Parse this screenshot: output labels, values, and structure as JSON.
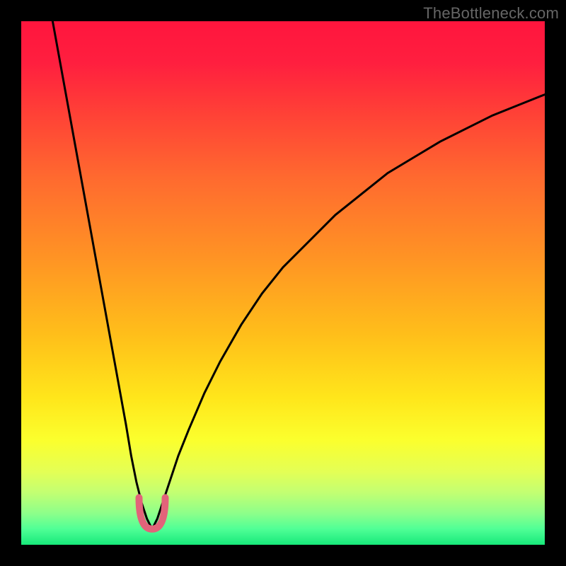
{
  "watermark": "TheBottleneck.com",
  "chart_data": {
    "type": "line",
    "title": "",
    "xlabel": "",
    "ylabel": "",
    "xlim": [
      0,
      100
    ],
    "ylim": [
      0,
      100
    ],
    "grid": false,
    "legend": false,
    "annotations": [],
    "description": "Two black curves descending to a shared minimum near x≈25 over a vertical rainbow gradient (red at top through green at bottom). A small pink U-shaped marker sits at the valley where the curves meet.",
    "series": [
      {
        "name": "left-curve",
        "x": [
          6,
          8,
          10,
          12,
          14,
          16,
          18,
          20,
          21,
          22,
          23,
          24,
          25
        ],
        "y": [
          100,
          89,
          78,
          67,
          56,
          45,
          34,
          23,
          17,
          12,
          8,
          5,
          3
        ]
      },
      {
        "name": "right-curve",
        "x": [
          25,
          26,
          27,
          28,
          30,
          32,
          35,
          38,
          42,
          46,
          50,
          55,
          60,
          65,
          70,
          75,
          80,
          85,
          90,
          95,
          100
        ],
        "y": [
          3,
          5,
          8,
          11,
          17,
          22,
          29,
          35,
          42,
          48,
          53,
          58,
          63,
          67,
          71,
          74,
          77,
          79.5,
          82,
          84,
          86
        ]
      }
    ],
    "valley_marker": {
      "x": 25,
      "y": 3,
      "width": 5,
      "height": 6
    },
    "gradient_stops": [
      {
        "offset": 0.0,
        "color": "#ff153d"
      },
      {
        "offset": 0.08,
        "color": "#ff1f3f"
      },
      {
        "offset": 0.18,
        "color": "#ff4236"
      },
      {
        "offset": 0.3,
        "color": "#ff6a2f"
      },
      {
        "offset": 0.45,
        "color": "#ff9324"
      },
      {
        "offset": 0.6,
        "color": "#ffbf1a"
      },
      {
        "offset": 0.72,
        "color": "#ffe61b"
      },
      {
        "offset": 0.8,
        "color": "#fbff2d"
      },
      {
        "offset": 0.86,
        "color": "#e4ff55"
      },
      {
        "offset": 0.9,
        "color": "#c3ff72"
      },
      {
        "offset": 0.94,
        "color": "#8dff8a"
      },
      {
        "offset": 0.97,
        "color": "#4fff96"
      },
      {
        "offset": 1.0,
        "color": "#17e97a"
      }
    ],
    "colors": {
      "curve": "#000000",
      "marker": "#e2637a",
      "frame": "#000000"
    }
  }
}
